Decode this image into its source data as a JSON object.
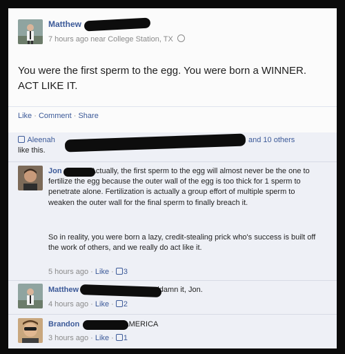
{
  "post": {
    "author": "Matthew",
    "time": "7 hours ago near College Station, TX",
    "text": "You were the first sperm to the egg. You were born a WINNER. ACT LIKE IT."
  },
  "actions": {
    "like": "Like",
    "comment": "Comment",
    "share": "Share",
    "dot": "·"
  },
  "likes": {
    "first_name": "Aleenah",
    "and_others": "and 10 others",
    "suffix": "like this."
  },
  "comments": [
    {
      "author": "Jon",
      "text_p1": "Actually, the first sperm to the egg will almost never be the one to fertilize the egg because the outer wall of the egg is too thick for 1 sperm to penetrate alone. Fertilization is actually a group effort of multiple sperm to weaken the outer wall for the final sperm to finally breach it.",
      "text_p2": "So in reality, you were born a lazy, credit-stealing prick who's success is built off the work of others, and we really do act like it.",
      "time": "5 hours ago",
      "like": "Like",
      "like_count": "3"
    },
    {
      "author": "Matthew",
      "text": "Goddamn it, Jon.",
      "time": "4 hours ago",
      "like": "Like",
      "like_count": "2"
    },
    {
      "author": "Brandon",
      "text": "AMERICA",
      "time": "3 hours ago",
      "like": "Like",
      "like_count": "1"
    }
  ],
  "colors": {
    "link": "#3b5998",
    "background": "#0b0b0b",
    "card": "#fbfbfb",
    "comments_bg": "#eef0f6"
  }
}
